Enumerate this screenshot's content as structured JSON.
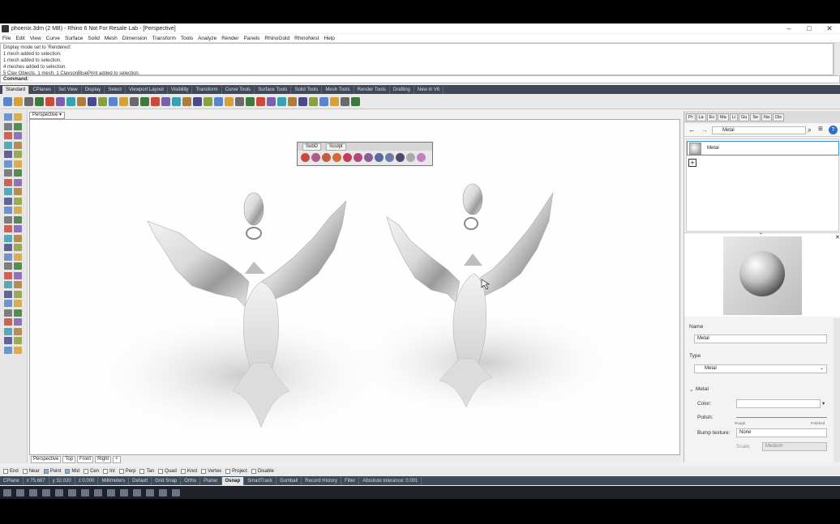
{
  "window": {
    "title": "phoenix.3dm (2 MB) - Rhino 6 Not For Resale Lab - [Perspective]",
    "minimize": "–",
    "maximize": "□",
    "close": "✕"
  },
  "menu": [
    "File",
    "Edit",
    "View",
    "Curve",
    "Surface",
    "Solid",
    "Mesh",
    "Dimension",
    "Transform",
    "Tools",
    "Analyze",
    "Render",
    "Panels",
    "RhinoGold",
    "RhinoNest",
    "Help"
  ],
  "history": [
    "Display mode set to 'Rendered'.",
    "1 mesh added to selection.",
    "1 mesh added to selection.",
    "4 meshes added to selection.",
    "5 Clay Objects, 1 mesh, 1 ClaysonBluePrint added to selection."
  ],
  "command": {
    "label": "Command:"
  },
  "toolbar_tabs": [
    "Standard",
    "CPlanes",
    "Set View",
    "Display",
    "Select",
    "Viewport Layout",
    "Visibility",
    "Transform",
    "Curve Tools",
    "Surface Tools",
    "Solid Tools",
    "Mesh Tools",
    "Render Tools",
    "Drafting",
    "New in V6"
  ],
  "active_toolbar_tab": "Standard",
  "viewport": {
    "active_label": "Perspective",
    "dropdown": "▾",
    "tabs": [
      "Perspective",
      "Top",
      "Front",
      "Right",
      "+"
    ]
  },
  "floating_toolbar": {
    "tabs": [
      "SubD",
      "Sculpt"
    ]
  },
  "right_panel": {
    "tabs": [
      "Pr",
      "La",
      "Ev",
      "Ma",
      "Li",
      "Gu",
      "Se",
      "Na",
      "Dis"
    ],
    "search_value": "Metal",
    "material_name": "Metal",
    "add_symbol": "+",
    "props": {
      "name_label": "Name",
      "name_value": "Metal",
      "type_label": "Type",
      "type_value": "Metal",
      "section_label": "Metal",
      "color_label": "Color:",
      "polish_label": "Polish:",
      "polish_min": "Rough",
      "polish_max": "Polished",
      "bump_label": "Bump texture:",
      "bump_value": "None",
      "scale_label": "Scale:",
      "scale_value": "Medium"
    }
  },
  "osnaps": [
    {
      "label": "End",
      "on": false
    },
    {
      "label": "Near",
      "on": false
    },
    {
      "label": "Point",
      "on": true
    },
    {
      "label": "Mid",
      "on": true
    },
    {
      "label": "Cen",
      "on": false
    },
    {
      "label": "Int",
      "on": false
    },
    {
      "label": "Perp",
      "on": false
    },
    {
      "label": "Tan",
      "on": false
    },
    {
      "label": "Quad",
      "on": false
    },
    {
      "label": "Knot",
      "on": false
    },
    {
      "label": "Vertex",
      "on": false
    },
    {
      "label": "Project",
      "on": false
    },
    {
      "label": "Disable",
      "on": false
    }
  ],
  "status": {
    "cplane": "CPlane",
    "x": "x 75.687",
    "y": "y 32.020",
    "z": "z 0.000",
    "units": "Millimeters",
    "layer": "Default",
    "toggles": [
      "Grid Snap",
      "Ortho",
      "Planar",
      "Osnap",
      "SmartTrack",
      "Gumball",
      "Record History",
      "Filter"
    ],
    "active_toggle": "Osnap",
    "tolerance": "Absolute tolerance: 0.001"
  },
  "colors": {
    "dark_chrome": "#3f4a59",
    "accent": "#3a8dd8",
    "viewport_bg": "#fefefe"
  }
}
